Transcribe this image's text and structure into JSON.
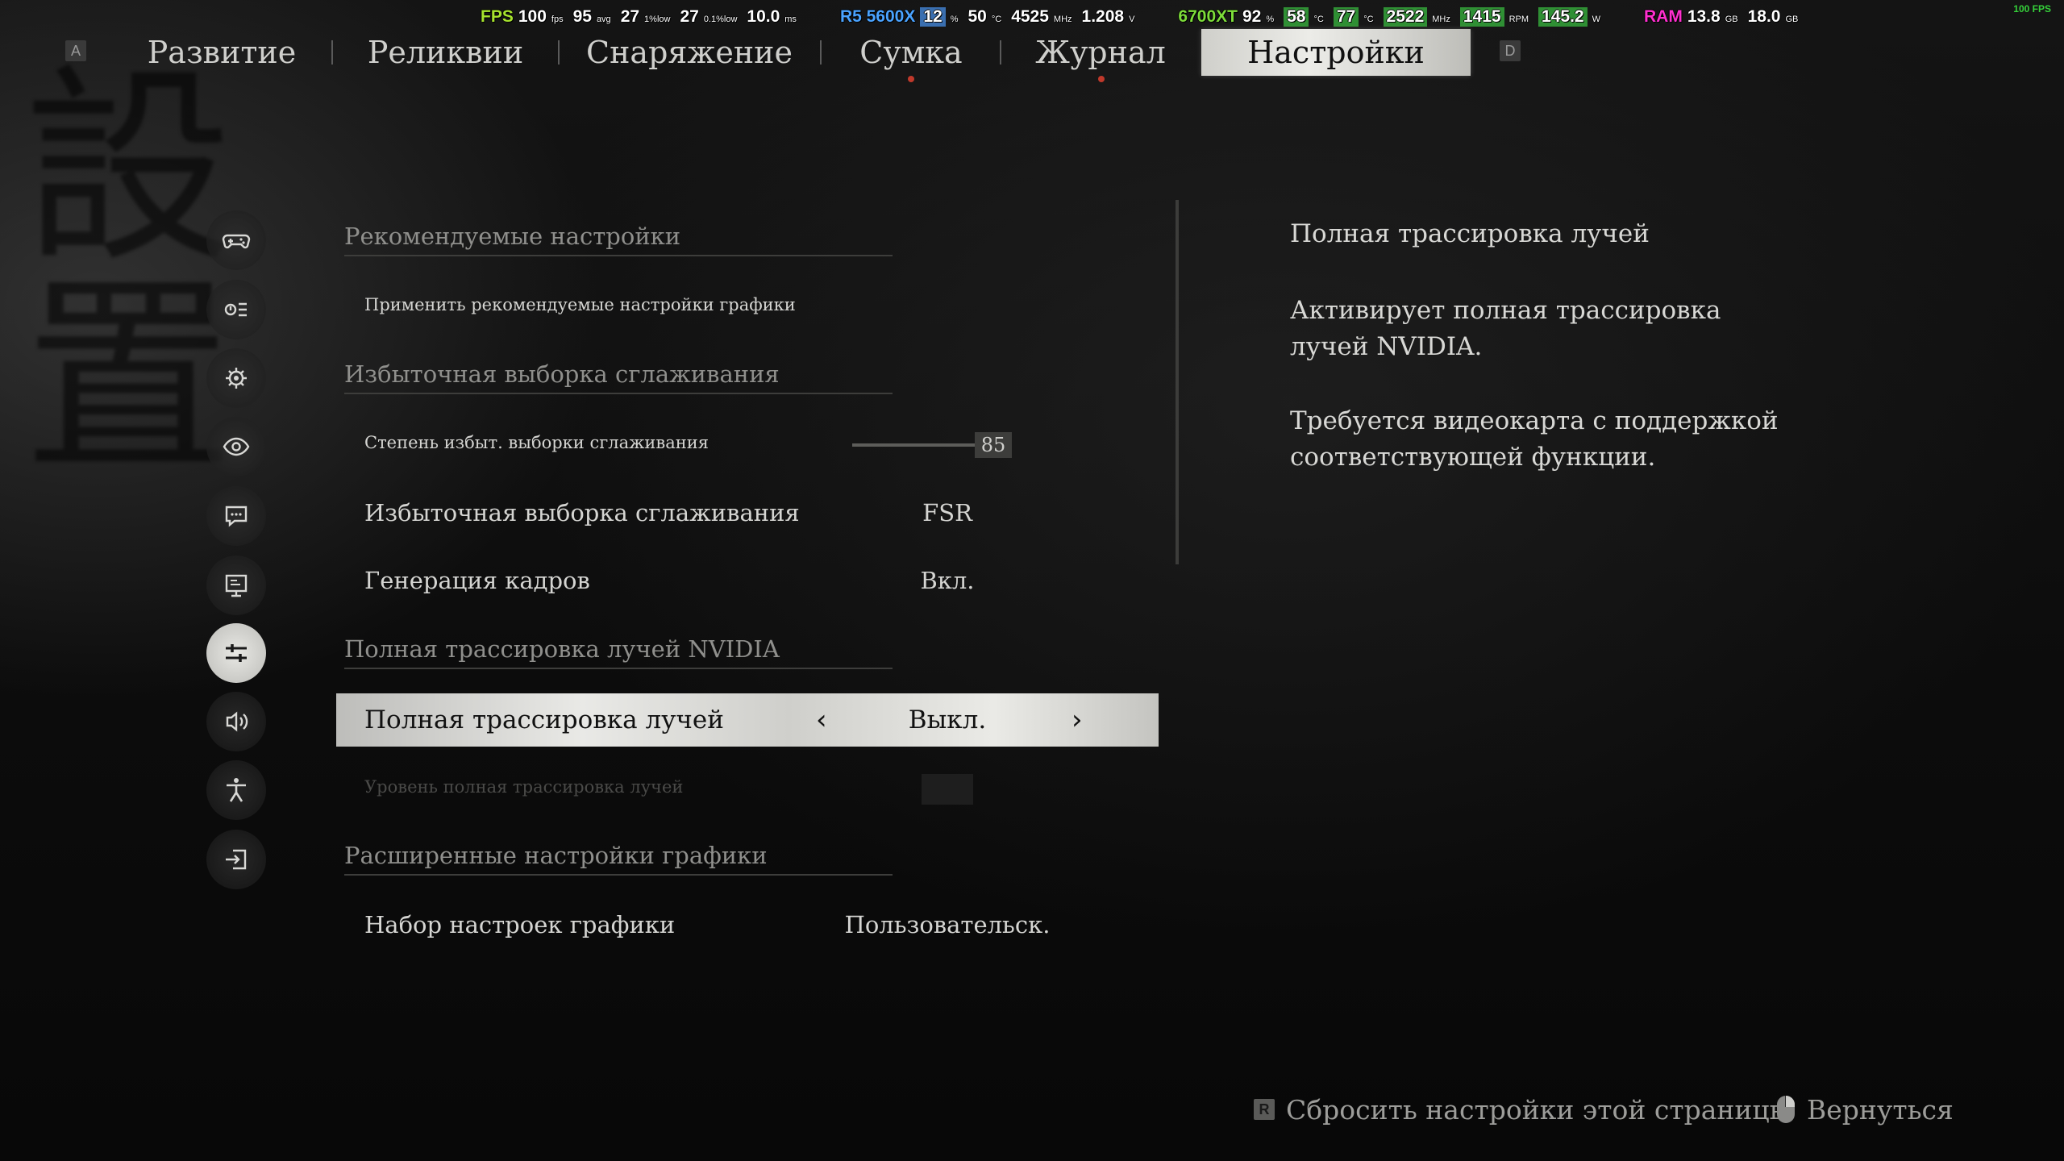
{
  "hud": {
    "fps_label": "FPS",
    "fps": "100",
    "fps_unit": "fps",
    "avg": "95",
    "avg_unit": "avg",
    "low1": "27",
    "low1_unit": "1%low",
    "low01": "27",
    "low01_unit": "0.1%low",
    "frametime": "10.0",
    "frametime_unit": "ms",
    "cpu_label": "R5 5600X",
    "cpu_load": "12",
    "cpu_load_unit": "%",
    "cpu_temp": "50",
    "cpu_temp_unit": "°C",
    "cpu_clock": "4525",
    "cpu_clock_unit": "MHz",
    "cpu_volt": "1.208",
    "cpu_volt_unit": "V",
    "gpu_label": "6700XT",
    "gpu_load": "92",
    "gpu_load_unit": "%",
    "gpu_temp": "58",
    "gpu_temp_unit": "°C",
    "gpu_hotspot": "77",
    "gpu_hotspot_unit": "°C",
    "gpu_clock": "2522",
    "gpu_clock_unit": "MHz",
    "gpu_fan": "1415",
    "gpu_fan_unit": "RPM",
    "gpu_power": "145.2",
    "gpu_power_unit": "W",
    "ram_label": "RAM",
    "ram_used": "13.8",
    "ram_used_unit": "GB",
    "ram_total": "18.0",
    "ram_total_unit": "GB",
    "corner_fps": "100 FPS",
    "colors": {
      "fps": "#a6e22e",
      "cpu": "#4aa3ff",
      "gpu": "#7ddc3a",
      "ram": "#ff2fcf",
      "corner": "#35d03a"
    }
  },
  "tabs": {
    "prev_key": "A",
    "next_key": "D",
    "items": [
      {
        "label": "Развитие"
      },
      {
        "label": "Реликвии"
      },
      {
        "label": "Снаряжение"
      },
      {
        "label": "Сумка"
      },
      {
        "label": "Журнал"
      },
      {
        "label": "Настройки"
      }
    ]
  },
  "side_icons": [
    "gamepad-icon",
    "keybind-icon",
    "gear-icon",
    "eye-icon",
    "chat-icon",
    "monitor-icon",
    "sliders-icon",
    "speaker-icon",
    "accessibility-icon",
    "exit-icon"
  ],
  "settings": {
    "sections": [
      "Рекомендуемые настройки",
      "Избыточная выборка сглаживания",
      "Полная трассировка лучей NVIDIA",
      "Расширенные настройки графики"
    ],
    "apply_recommended": "Применить рекомендуемые настройки графики",
    "supersampling_degree": {
      "label": "Степень избыт. выборки сглаживания",
      "value": "85",
      "level": 0.85
    },
    "supersampling": {
      "label": "Избыточная выборка сглаживания",
      "value": "FSR"
    },
    "frame_generation": {
      "label": "Генерация кадров",
      "value": "Вкл."
    },
    "full_ray_tracing": {
      "label": "Полная трассировка лучей",
      "value": "Выкл."
    },
    "ray_tracing_level": {
      "label": "Уровень полная трассировка лучей"
    },
    "graphics_preset": {
      "label": "Набор настроек графики",
      "value": "Пользовательск."
    }
  },
  "description": {
    "title": "Полная трассировка лучей",
    "para1": "Активирует полная трассировка лучей NVIDIA.",
    "para2": "Требуется видеокарта с поддержкой соответствующей функции."
  },
  "footer": {
    "reset_key": "R",
    "reset_label": "Сбросить настройки этой страницы",
    "back_label": "Вернуться"
  }
}
